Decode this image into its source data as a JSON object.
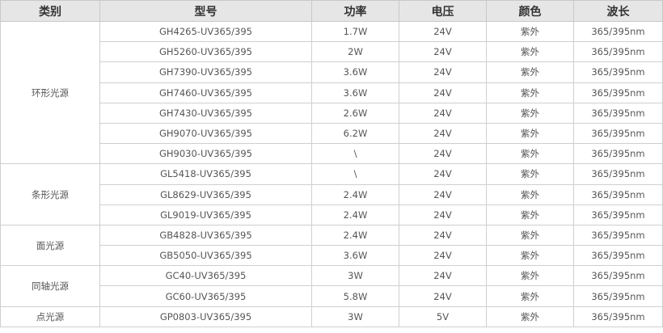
{
  "headers": [
    "类别",
    "型号",
    "功率",
    "电压",
    "颜色",
    "波长"
  ],
  "groups": [
    {
      "category": "环形光源",
      "rows": [
        [
          "GH4265-UV365/395",
          "1.7W",
          "24V",
          "紫外",
          "365/395nm"
        ],
        [
          "GH5260-UV365/395",
          "2W",
          "24V",
          "紫外",
          "365/395nm"
        ],
        [
          "GH7390-UV365/395",
          "3.6W",
          "24V",
          "紫外",
          "365/395nm"
        ],
        [
          "GH7460-UV365/395",
          "3.6W",
          "24V",
          "紫外",
          "365/395nm"
        ],
        [
          "GH7430-UV365/395",
          "2.6W",
          "24V",
          "紫外",
          "365/395nm"
        ],
        [
          "GH9070-UV365/395",
          "6.2W",
          "24V",
          "紫外",
          "365/395nm"
        ],
        [
          "GH9030-UV365/395",
          "\\",
          "24V",
          "紫外",
          "365/395nm"
        ]
      ]
    },
    {
      "category": "条形光源",
      "rows": [
        [
          "GL5418-UV365/395",
          "\\",
          "24V",
          "紫外",
          "365/395nm"
        ],
        [
          "GL8629-UV365/395",
          "2.4W",
          "24V",
          "紫外",
          "365/395nm"
        ],
        [
          "GL9019-UV365/395",
          "2.4W",
          "24V",
          "紫外",
          "365/395nm"
        ]
      ]
    },
    {
      "category": "面光源",
      "rows": [
        [
          "GB4828-UV365/395",
          "2.4W",
          "24V",
          "紫外",
          "365/395nm"
        ],
        [
          "GB5050-UV365/395",
          "3.6W",
          "24V",
          "紫外",
          "365/395nm"
        ]
      ]
    },
    {
      "category": "同轴光源",
      "rows": [
        [
          "GC40-UV365/395",
          "3W",
          "24V",
          "紫外",
          "365/395nm"
        ],
        [
          "GC60-UV365/395",
          "5.8W",
          "24V",
          "紫外",
          "365/395nm"
        ]
      ]
    },
    {
      "category": "点光源",
      "rows": [
        [
          "GP0803-UV365/395",
          "3W",
          "5V",
          "紫外",
          "365/395nm"
        ]
      ]
    }
  ]
}
